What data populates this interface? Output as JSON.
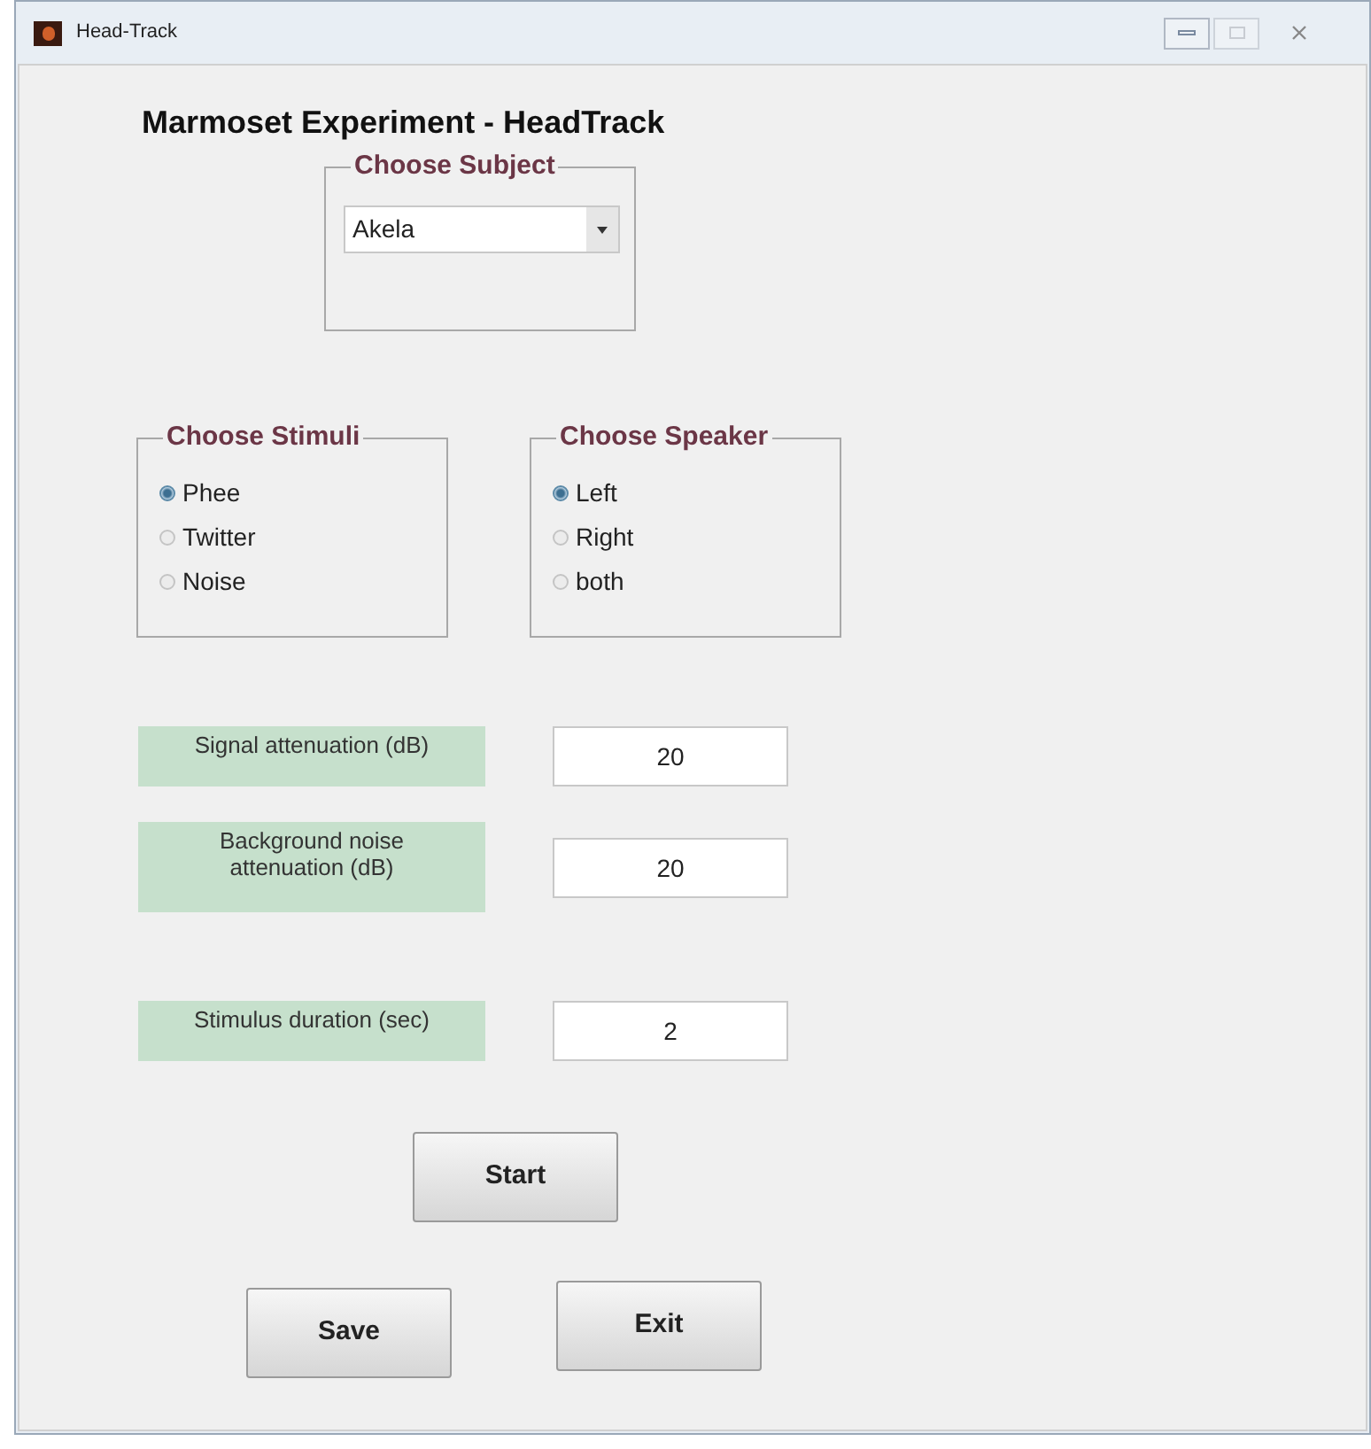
{
  "window": {
    "title": "Head-Track"
  },
  "heading": "Marmoset Experiment - HeadTrack",
  "subject": {
    "title": "Choose Subject",
    "value": "Akela"
  },
  "stimuli": {
    "title": "Choose Stimuli",
    "options": [
      {
        "label": "Phee",
        "selected": true
      },
      {
        "label": "Twitter",
        "selected": false
      },
      {
        "label": "Noise",
        "selected": false
      }
    ]
  },
  "speaker": {
    "title": "Choose Speaker",
    "options": [
      {
        "label": "Left",
        "selected": true
      },
      {
        "label": "Right",
        "selected": false
      },
      {
        "label": "both",
        "selected": false
      }
    ]
  },
  "parameters": [
    {
      "label": "Signal attenuation (dB)",
      "value": "20"
    },
    {
      "label": "Background noise attenuation (dB)",
      "value": "20"
    },
    {
      "label": "Stimulus duration (sec)",
      "value": "2"
    }
  ],
  "buttons": {
    "start": "Start",
    "save": "Save",
    "exit": "Exit"
  }
}
